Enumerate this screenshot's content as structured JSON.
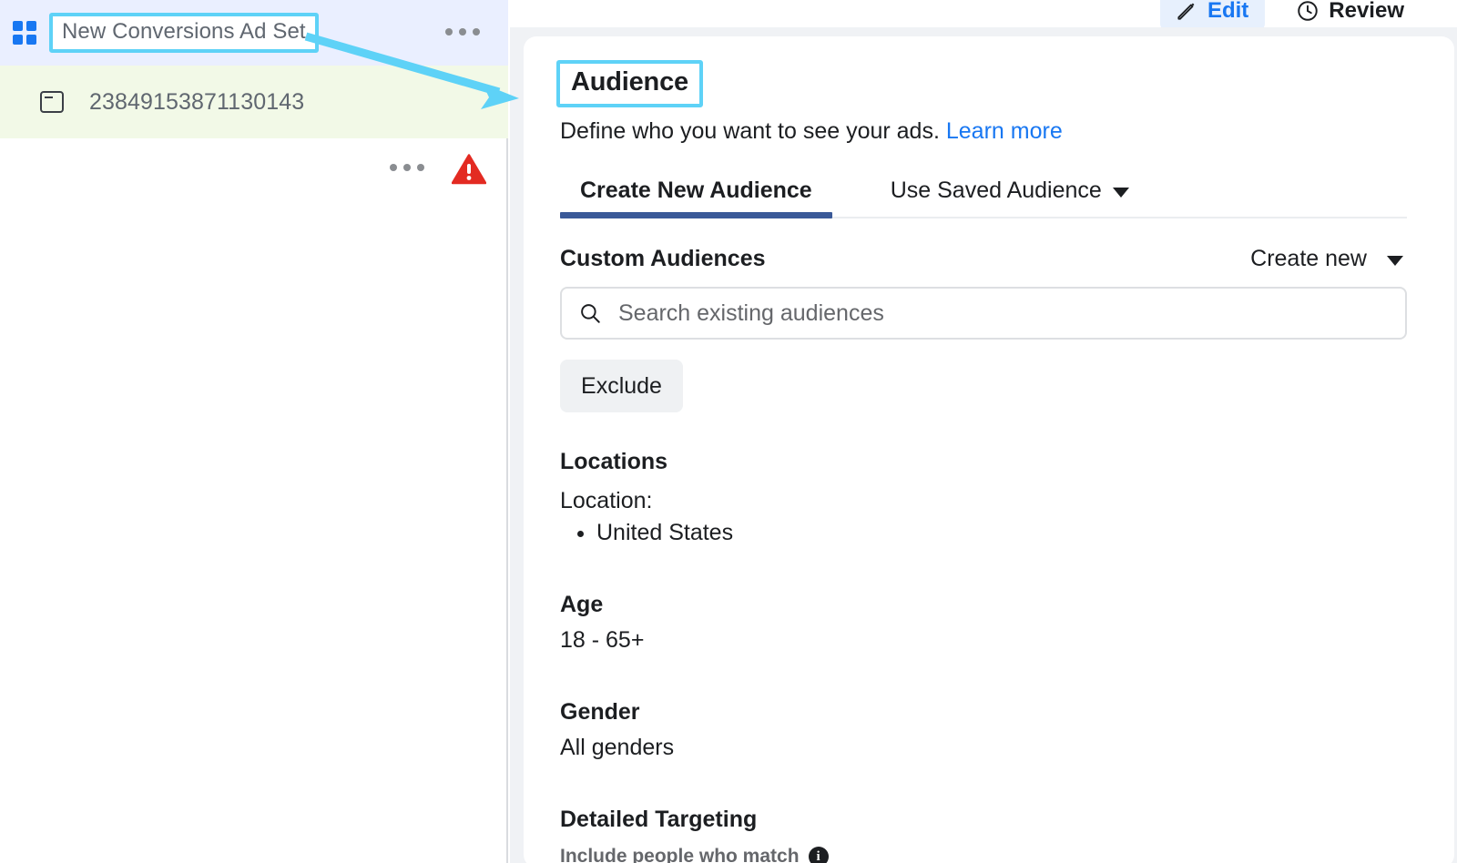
{
  "sidebar": {
    "adset_row": {
      "icon": "grid-icon",
      "name": "New Conversions Ad Set",
      "menu_icon": "kebab-menu-icon",
      "background_color": "#eaefff",
      "highlight_color": "#5ed2f7"
    },
    "ad_row": {
      "icon": "ad-window-icon",
      "name": "23849153871130143",
      "menu_icon": "kebab-menu-icon",
      "status_icon": "warning-triangle-icon",
      "status_color": "#e32b22",
      "background_color": "#f2f9e7"
    }
  },
  "top_actions": {
    "edit": {
      "label": "Edit",
      "icon": "pencil-icon",
      "color": "#1877f2",
      "background": "#e7f0fd"
    },
    "review": {
      "label": "Review",
      "icon": "clock-icon",
      "color": "#1c1e21"
    }
  },
  "audience": {
    "heading": "Audience",
    "subtitle": "Define who you want to see your ads.",
    "learn_more": "Learn more",
    "tabs": [
      {
        "label": "Create New Audience",
        "active": true,
        "has_chevron": false
      },
      {
        "label": "Use Saved Audience",
        "active": false,
        "has_chevron": true
      }
    ],
    "custom_audiences": {
      "label": "Custom Audiences",
      "create_new_label": "Create new",
      "search_placeholder": "Search existing audiences",
      "search_value": "",
      "search_icon": "search-icon",
      "exclude_label": "Exclude"
    },
    "locations": {
      "title": "Locations",
      "location_label": "Location:",
      "items": [
        "United States"
      ]
    },
    "age": {
      "title": "Age",
      "value": "18 - 65+"
    },
    "gender": {
      "title": "Gender",
      "value": "All genders"
    },
    "detailed_targeting": {
      "title": "Detailed Targeting",
      "include_label": "Include people who match",
      "info_icon": "info-icon",
      "info_glyph": "i"
    }
  },
  "annotation": {
    "color": "#5ed2f7",
    "type": "arrow",
    "from": "adset-name-box",
    "to": "audience-heading-box"
  }
}
